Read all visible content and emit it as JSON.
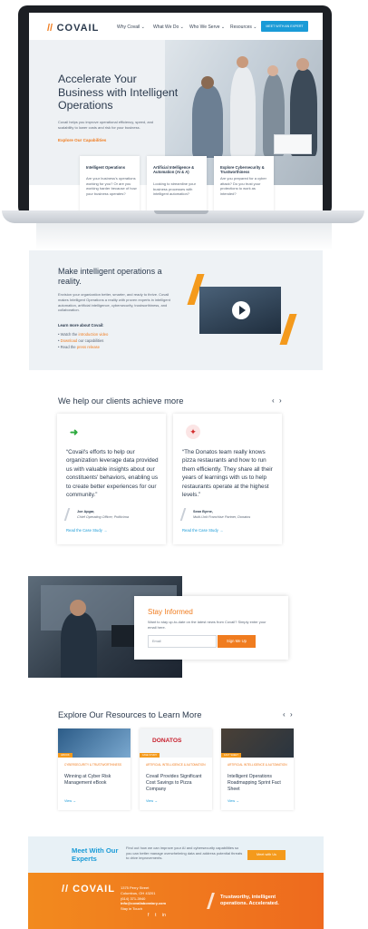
{
  "laptop_site": {
    "logo": {
      "slash": "//",
      "name": "COVAIL"
    },
    "nav": [
      "Why Covail ⌄",
      "What We Do ⌄",
      "Who We Serve ⌄",
      "Resources ⌄"
    ],
    "nav_button": "MEET WITH AN EXPERT",
    "hero": {
      "title": "Accelerate Your Business with Intelligent Operations",
      "subtitle": "Covail helps you improve operational efficiency, speed, and scalability to lower costs and risk for your business.",
      "link": "Explore Our Capabilities"
    },
    "cards": [
      {
        "title": "Intelligent Operations",
        "text": "Are your business's operations working for you? Or are you working harder because of how your business operates?"
      },
      {
        "title": "Artificial Intelligence & Automation (AI & A)",
        "text": "Looking to streamline your business processes with intelligent automation?"
      },
      {
        "title": "Explore Cybersecurity & Trustworthiness",
        "text": "Are you prepared for a cyber attack? Do you trust your protections to work as intended?"
      }
    ]
  },
  "intro": {
    "title": "Make intelligent operations a reality.",
    "text": "Envision your organization better, smarter, and ready to thrive. Covail makes Intelligent Operations a reality with proven experts in intelligent automation, artificial intelligence, cybersecurity, trustworthiness, and collaboration.",
    "learn_more": "Learn more about Covail:",
    "items": [
      {
        "pre": "Watch the ",
        "link": "introduction video"
      },
      {
        "pre": "",
        "link": "Download",
        "post": " our capabilities"
      },
      {
        "pre": "Read the ",
        "link": "press release"
      }
    ]
  },
  "testimonials": {
    "title": "We help our clients achieve more",
    "prev": "‹",
    "next": "›",
    "items": [
      {
        "quote": "“Covail's efforts to help our organization leverage data provided us with valuable insights about our constituents' behaviors, enabling us to create better experiences for our community.”",
        "name": "Joe Apgar,",
        "role": "Chief Operating Officer, Politicima",
        "link": "Read the Case Study →"
      },
      {
        "quote": "“The Donatos team really knows pizza restaurants and how to run them efficiently. They share all their years of learnings with us to help restaurants operate at the highest levels.”",
        "name": "Sean Byrne,",
        "role": "Multi-Unit Franchise Partner, Donatos",
        "link": "Read the Case Study →"
      }
    ]
  },
  "newsletter": {
    "title": "Stay Informed",
    "text": "Want to stay up-to-date on the latest news from Covail? Simply enter your email here.",
    "placeholder": "Email",
    "button": "Sign Me Up"
  },
  "resources": {
    "title": "Explore Our Resources to Learn More",
    "prev": "‹",
    "next": "›",
    "items": [
      {
        "tag": "EBOOK",
        "category": "CYBERSECURITY & TRUSTWORTHINESS",
        "title": "Winning at Cyber Risk Management eBook",
        "view": "View →"
      },
      {
        "tag": "CASE STUDY",
        "category": "ARTIFICIAL INTELLIGENCE & AUTOMATION",
        "title": "Covail Provides Significant Cost Savings to Pizza Company",
        "view": "View →",
        "brand": "DONATOS"
      },
      {
        "tag": "FACT SHEET",
        "category": "ARTIFICIAL INTELLIGENCE & AUTOMATION",
        "title": "Intelligent Operations Roadmapping Sprint Fact Sheet",
        "view": "View →"
      }
    ]
  },
  "meet": {
    "title": "Meet With Our Experts",
    "text": "Find out how we can improve your AI and cybersecurity capabilities so you can better manage overwhelming data and address potential threats to drive improvements.",
    "button": "Meet with Us"
  },
  "footer": {
    "logo": "// COVAIL",
    "address": [
      "1375 Perry Street",
      "Columbus, OH 43201",
      "(614) 371-3940",
      "info@covailaboratory.com",
      "Stay in Touch"
    ],
    "tagline": "Trustworthy, intelligent operations. Accelerated.",
    "social": [
      "f",
      "t",
      "in"
    ]
  },
  "colors": {
    "accent": "#f07c1f",
    "link": "#1a9bd7",
    "dark": "#2b3a4d"
  }
}
